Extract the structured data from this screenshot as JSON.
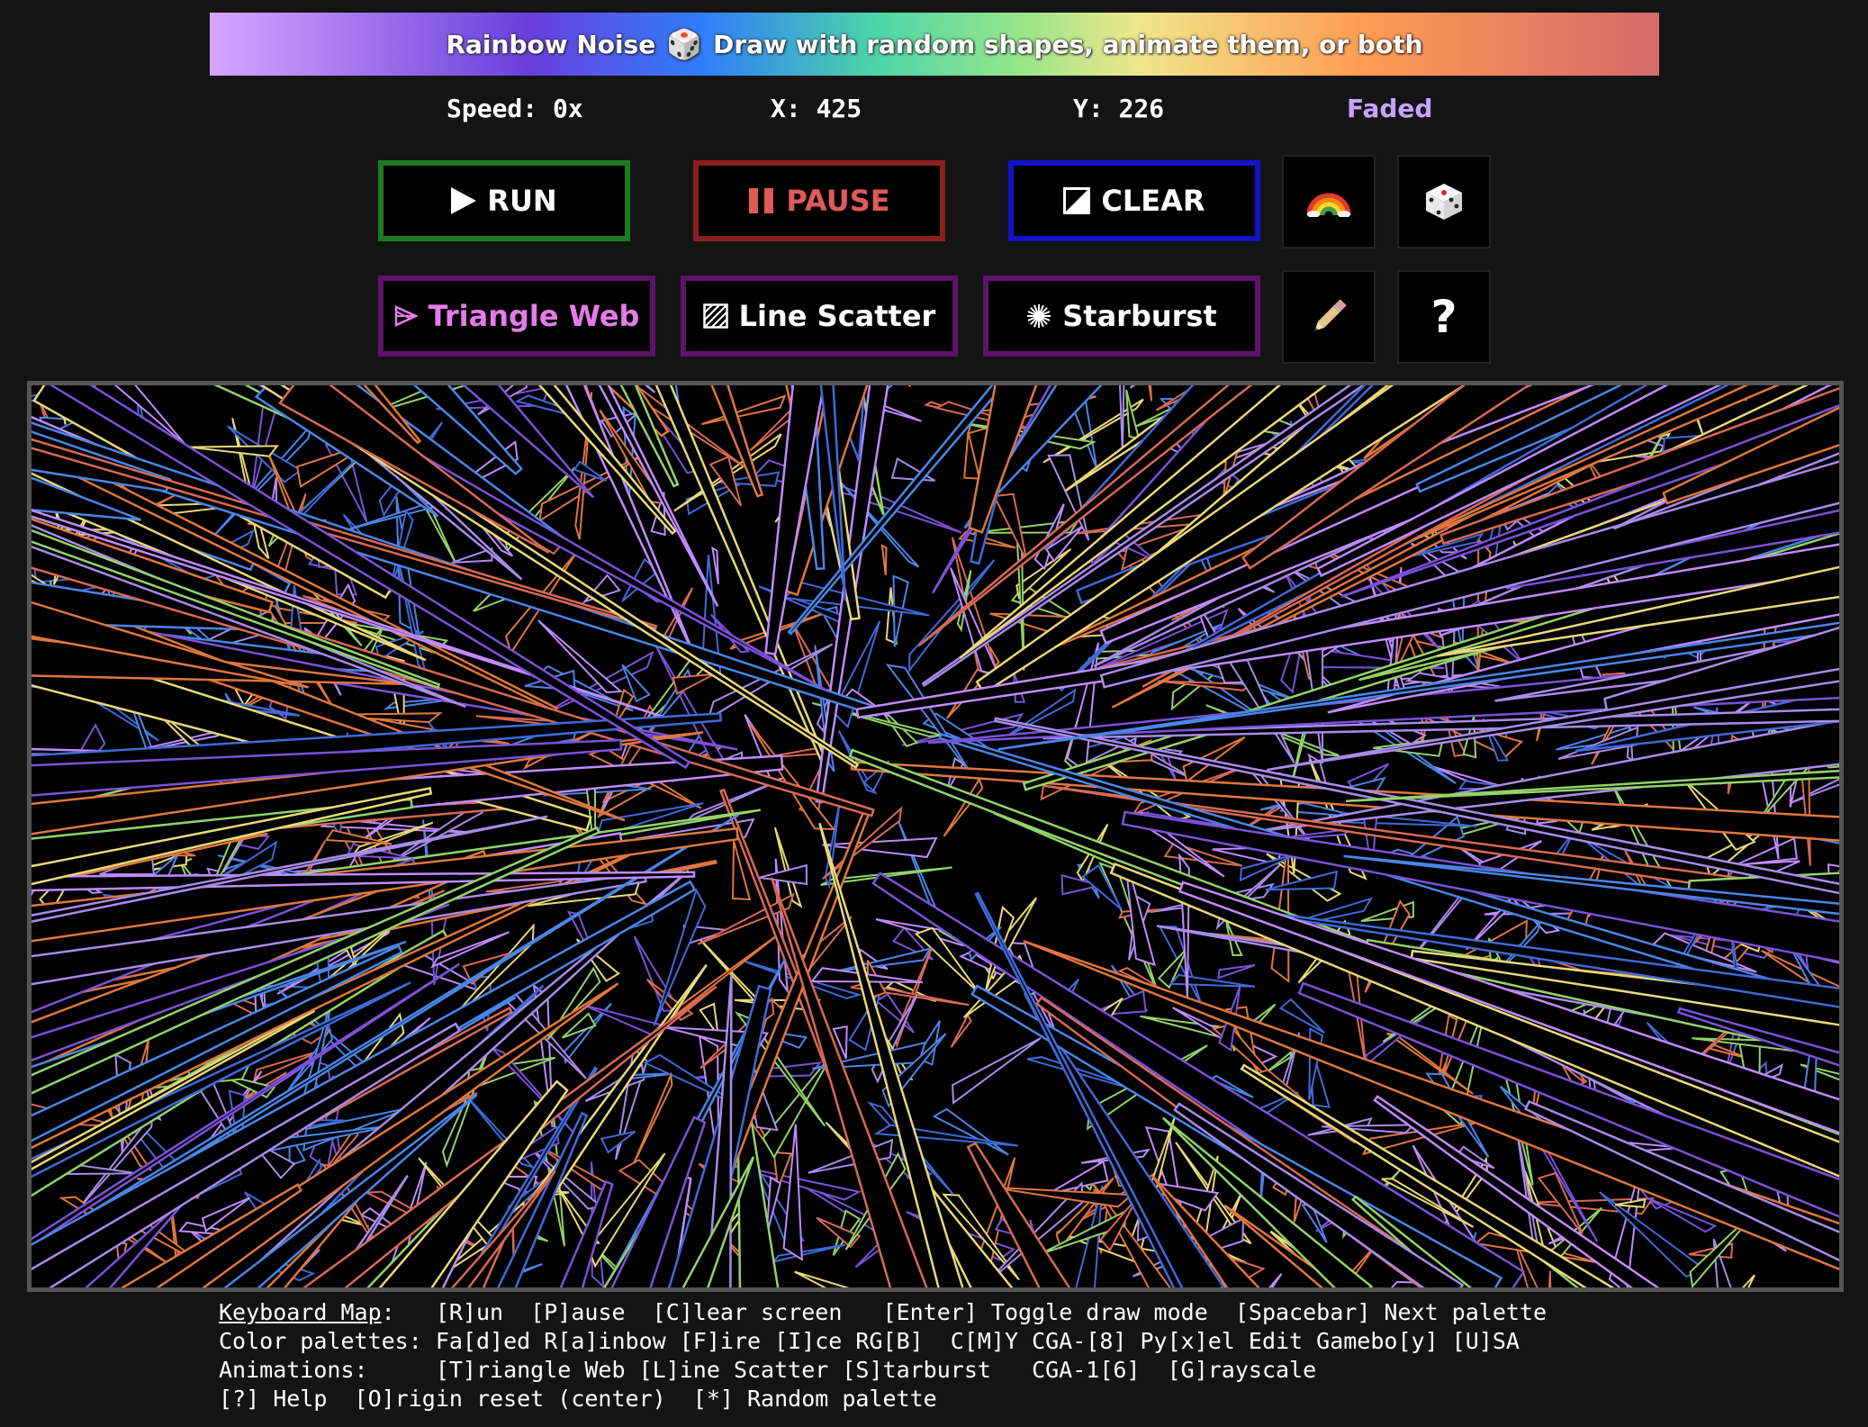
{
  "banner": {
    "title": "Rainbow Noise",
    "die_icon": "🎲",
    "subtitle": "Draw with random shapes, animate them, or both"
  },
  "status": {
    "speed": "Speed: 0x",
    "x": "X: 425",
    "y": "Y: 226",
    "palette": "Faded"
  },
  "controls": {
    "run": "RUN",
    "pause": "PAUSE",
    "clear": "CLEAR",
    "rainbow_icon": "🌈",
    "dice_icon": "🎲",
    "help": "?"
  },
  "animations": {
    "triangle_web": "Triangle Web",
    "line_scatter": "Line Scatter",
    "starburst": "Starburst"
  },
  "canvas": {
    "palette_colors": [
      "#e0773e",
      "#a98bea",
      "#4a86e8",
      "#7a52d8",
      "#93d36b",
      "#e8d97a",
      "#d86a54",
      "#c08bff",
      "#3f6ad8"
    ]
  },
  "keymap": {
    "line1_label": "Keyboard Map",
    "line1_rest": ":   [R]un  [P]ause  [C]lear screen   [Enter] Toggle draw mode  [Spacebar] Next palette",
    "line2": "Color palettes: Fa[d]ed R[a]inbow [F]ire [I]ce RG[B]  C[M]Y CGA-[8] Py[x]el Edit Gamebo[y] [U]SA",
    "line3": "Animations:     [T]riangle Web [L]ine Scatter [S]tarburst   CGA-1[6]  [G]rayscale",
    "line4": "[?] Help  [O]rigin reset (center)  [*] Random palette"
  }
}
